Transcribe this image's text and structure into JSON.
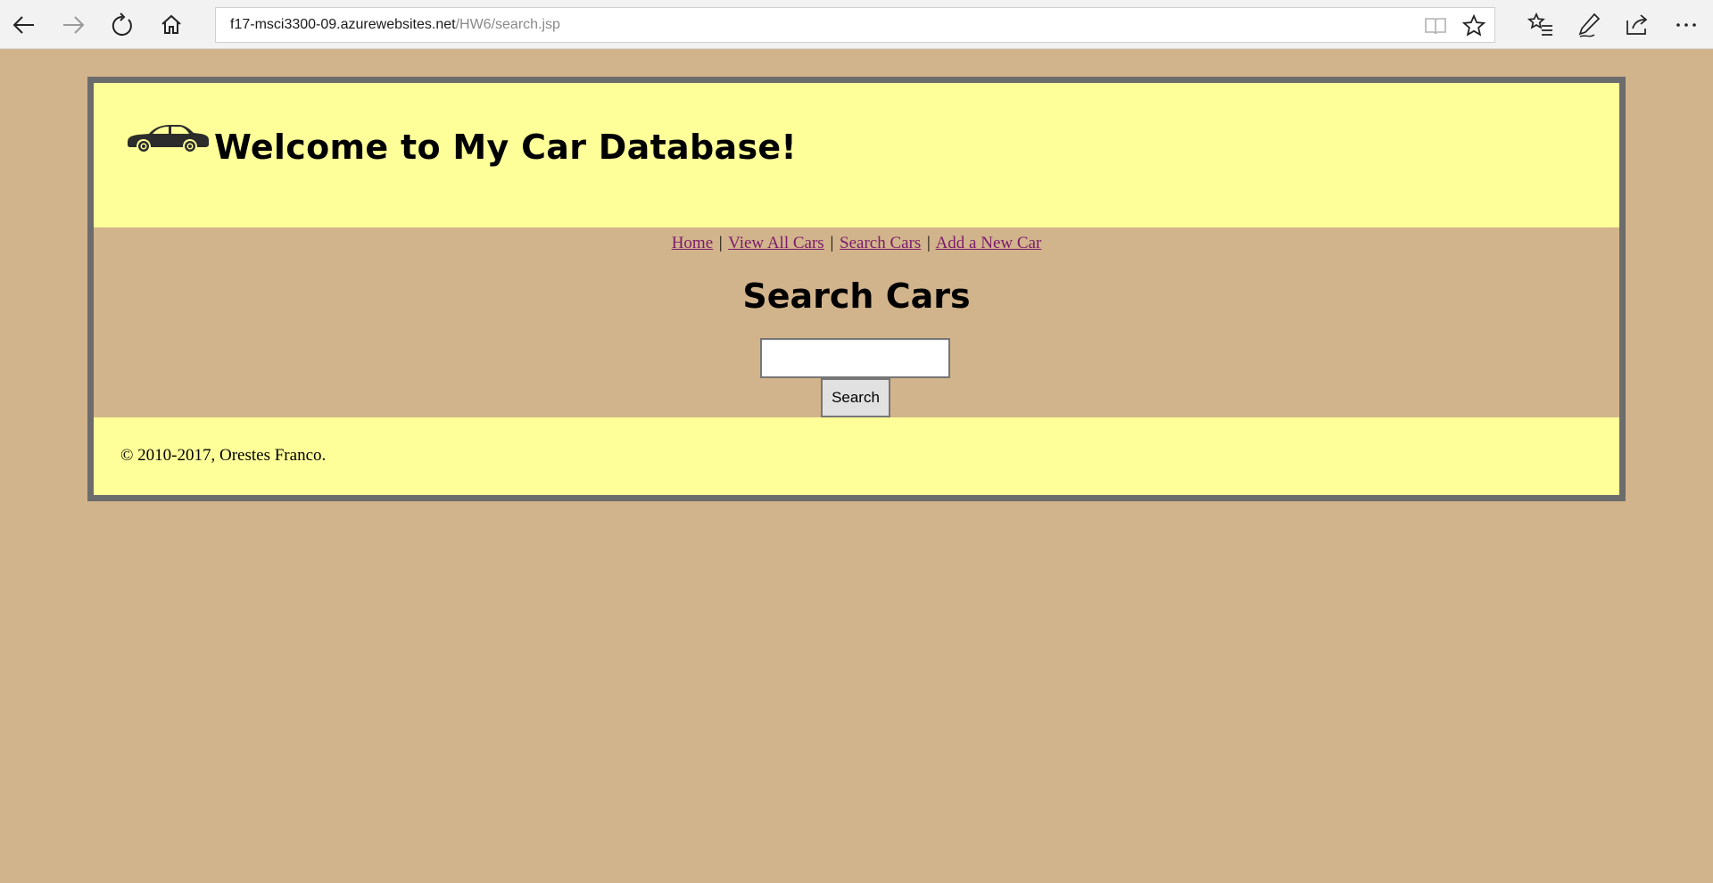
{
  "browser": {
    "url_host": "f17-msci3300-09.azurewebsites.net",
    "url_path": "/HW6/search.jsp",
    "icons": {
      "back": "back-arrow-icon",
      "forward": "forward-arrow-icon",
      "refresh": "refresh-icon",
      "home": "home-icon",
      "reading_view": "reading-view-icon",
      "favorite": "star-icon",
      "favorites_hub": "favorites-list-icon",
      "notes": "pen-icon",
      "share": "share-icon",
      "more": "more-icon"
    }
  },
  "header": {
    "title": "Welcome to My Car Database!",
    "logo_icon": "car-icon"
  },
  "nav": {
    "items": [
      {
        "label": "Home"
      },
      {
        "label": "View All Cars"
      },
      {
        "label": "Search Cars"
      },
      {
        "label": "Add a New Car"
      }
    ],
    "separator": "|"
  },
  "main": {
    "heading": "Search Cars",
    "search_value": "",
    "search_button_label": "Search"
  },
  "footer": {
    "copyright": "© 2010-2017, Orestes Franco."
  },
  "colors": {
    "page_background": "#d2b48c",
    "header_background": "#ffff99",
    "frame_border": "#6c6c6c",
    "link": "#7b1a6b"
  }
}
